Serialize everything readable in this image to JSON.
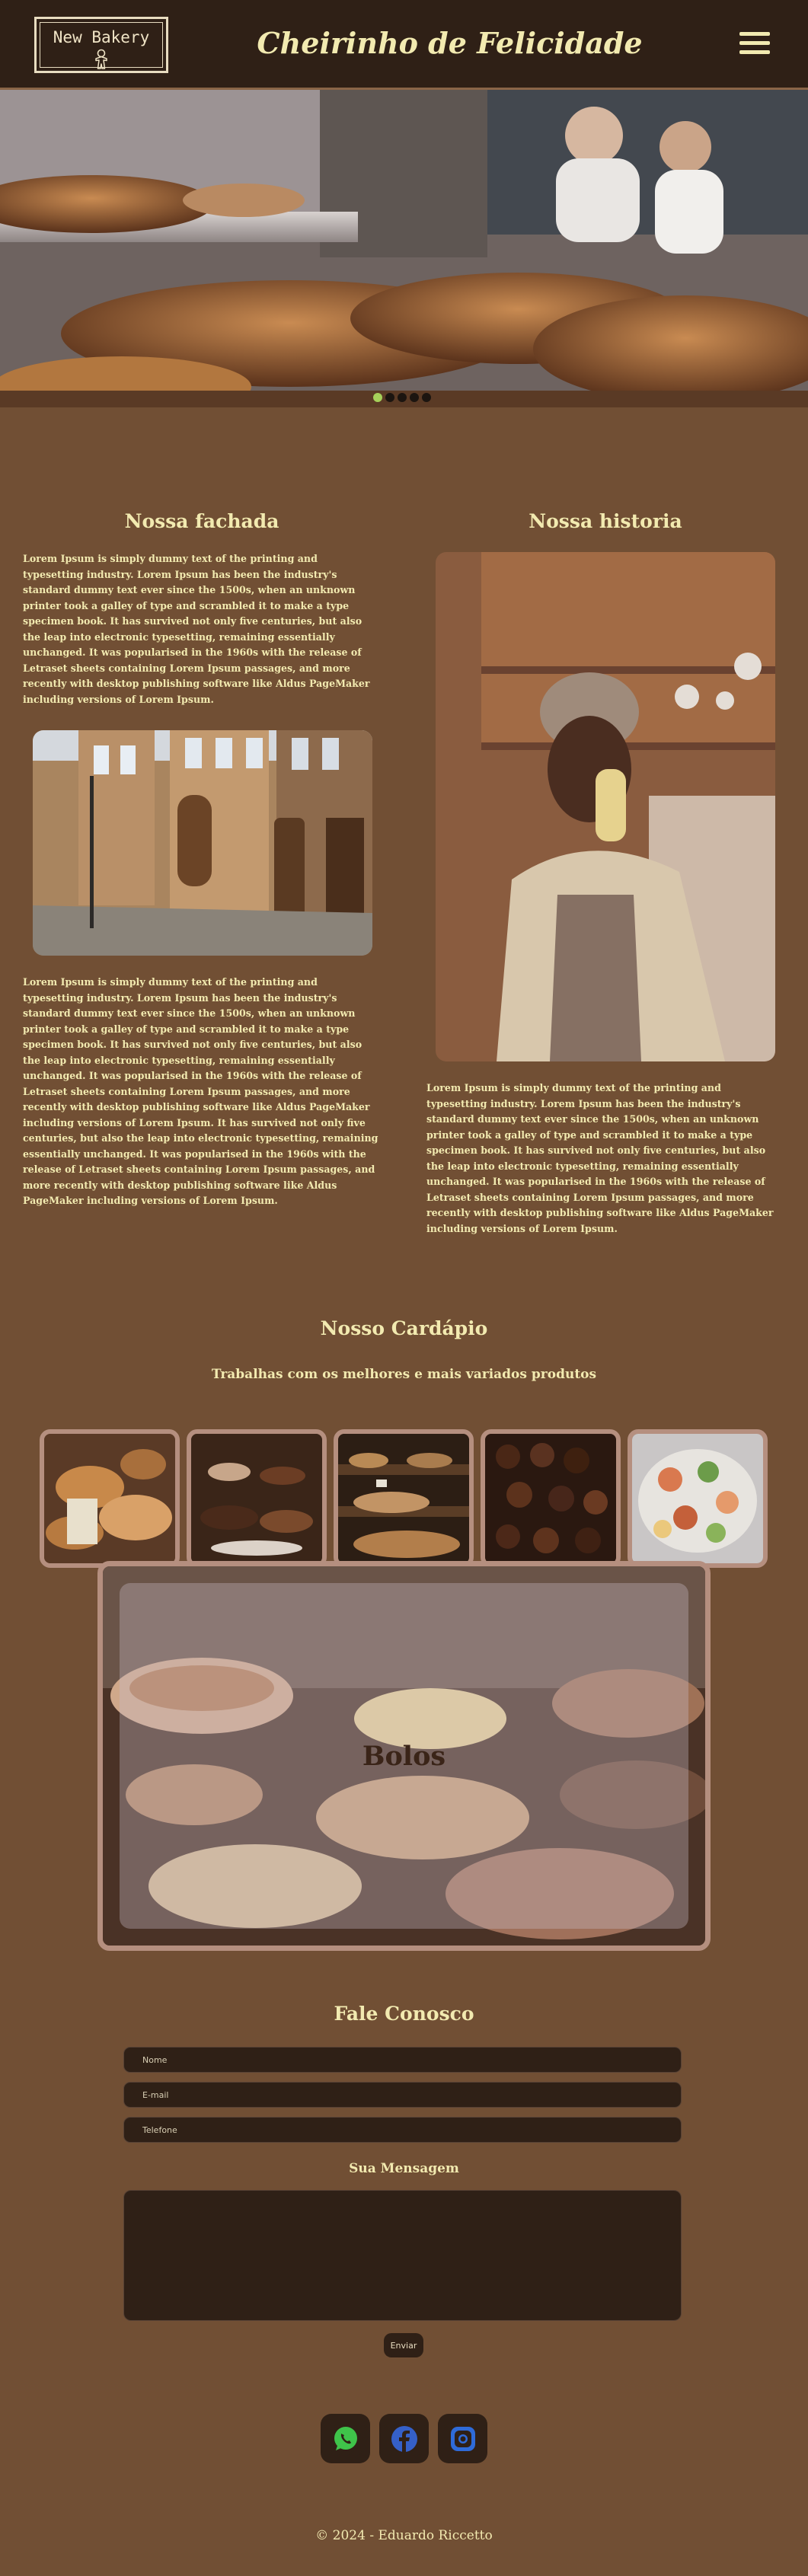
{
  "header": {
    "logo_text": "New Bakery",
    "title": "Cheirinho de Felicidade",
    "menu_icon": "hamburger-icon"
  },
  "carousel": {
    "slides": 5,
    "active_index": 0
  },
  "facade": {
    "heading": "Nossa fachada",
    "paragraph_1": "Lorem Ipsum is simply dummy text of the printing and typesetting industry. Lorem Ipsum has been the industry's standard dummy text ever since the 1500s, when an unknown printer took a galley of type and scrambled it to make a type specimen book. It has survived not only five centuries, but also the leap into electronic typesetting, remaining essentially unchanged. It was popularised in the 1960s with the release of Letraset sheets containing Lorem Ipsum passages, and more recently with desktop publishing software like Aldus PageMaker including versions of Lorem Ipsum.",
    "paragraph_2": "Lorem Ipsum is simply dummy text of the printing and typesetting industry. Lorem Ipsum has been the industry's standard dummy text ever since the 1500s, when an unknown printer took a galley of type and scrambled it to make a type specimen book. It has survived not only five centuries, but also the leap into electronic typesetting, remaining essentially unchanged. It was popularised in the 1960s with the release of Letraset sheets containing Lorem Ipsum passages, and more recently with desktop publishing software like Aldus PageMaker including versions of Lorem Ipsum. It has survived not only five centuries, but also the leap into electronic typesetting, remaining essentially unchanged. It was popularised in the 1960s with the release of Letraset sheets containing Lorem Ipsum passages, and more recently with desktop publishing software like Aldus PageMaker including versions of Lorem Ipsum."
  },
  "history": {
    "heading": "Nossa historia",
    "paragraph": "Lorem Ipsum is simply dummy text of the printing and typesetting industry. Lorem Ipsum has been the industry's standard dummy text ever since the 1500s, when an unknown printer took a galley of type and scrambled it to make a type specimen book. It has survived not only five centuries, but also the leap into electronic typesetting, remaining essentially unchanged. It was popularised in the 1960s with the release of Letraset sheets containing Lorem Ipsum passages, and more recently with desktop publishing software like Aldus PageMaker including versions of Lorem Ipsum."
  },
  "menu": {
    "heading": "Nosso Cardápio",
    "subheading": "Trabalhas com os melhores e mais variados produtos",
    "featured_label": "Bolos"
  },
  "contact": {
    "heading": "Fale Conosco",
    "name_placeholder": "Nome",
    "email_placeholder": "E-mail",
    "phone_placeholder": "Telefone",
    "message_label": "Sua Mensagem",
    "send_label": "Enviar"
  },
  "socials": [
    "whatsapp-icon",
    "facebook-icon",
    "instagram-icon"
  ],
  "footer": {
    "text": "© 2024 - Eduardo Riccetto"
  },
  "colors": {
    "page_bg": "#714f34",
    "header_bg": "#2f2016",
    "text": "#f2eab0",
    "frame": "#b58f7f",
    "active_dot": "#a6d05a",
    "whatsapp": "#3fc34a",
    "facebook": "#3560c8",
    "instagram": "#2f6bd8"
  }
}
